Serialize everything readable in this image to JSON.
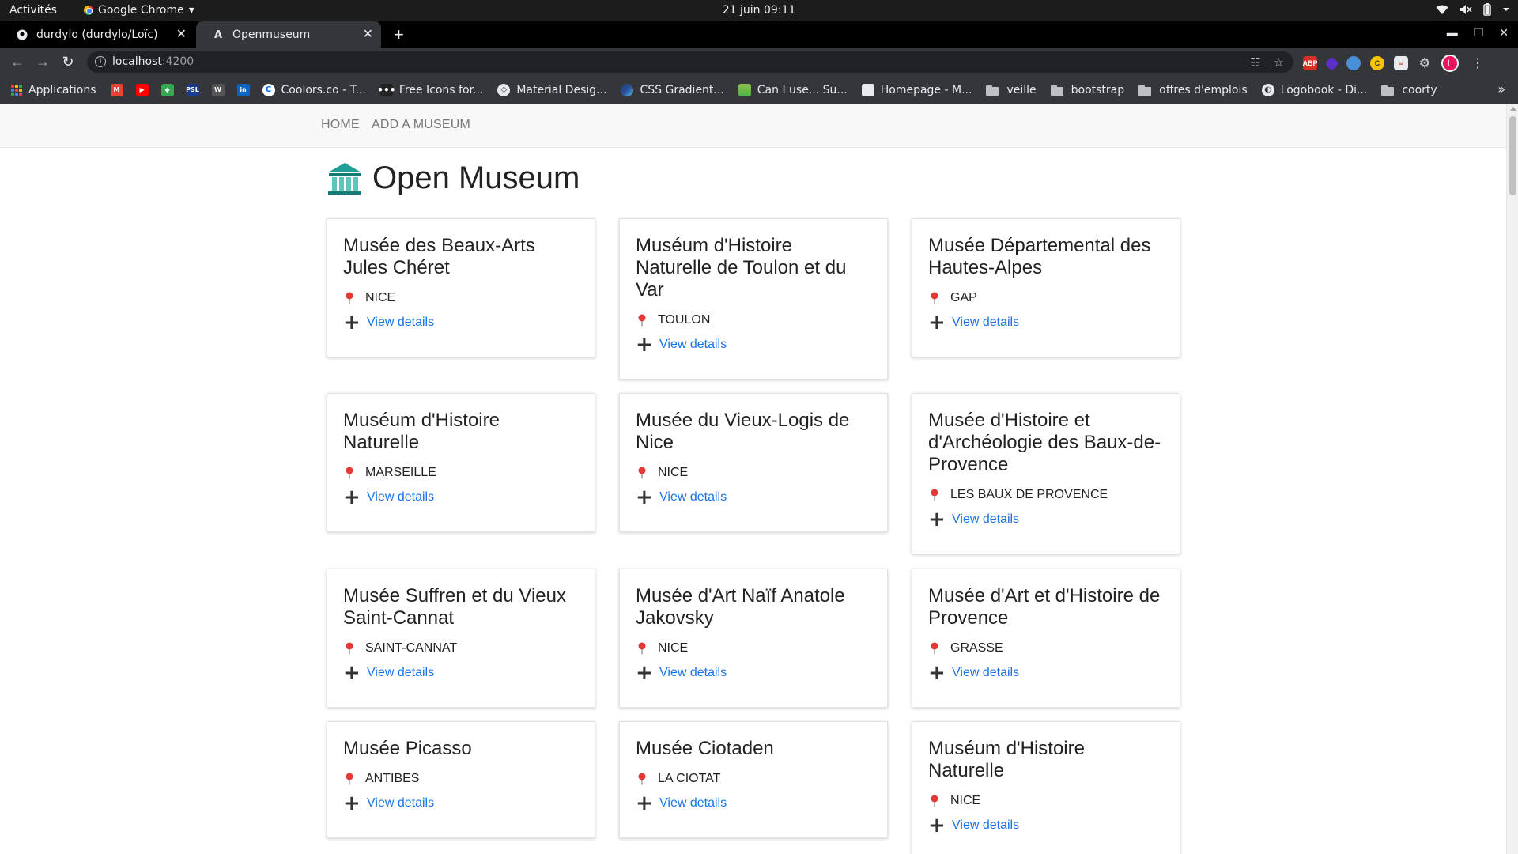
{
  "system_bar": {
    "activities": "Activités",
    "app_name": "Google Chrome",
    "clock": "21 juin  09:11"
  },
  "browser": {
    "tabs": [
      {
        "title": "durdylo (durdylo/Loïc)",
        "favicon": "github-icon"
      },
      {
        "title": "Openmuseum",
        "favicon": "angular-icon"
      }
    ],
    "url_host": "localhost",
    "url_port": ":4200",
    "avatar_letter": "L",
    "bookmarks": [
      {
        "label": "Applications",
        "icon": "apps-grid-icon"
      },
      {
        "label": "Coolors.co - T...",
        "icon": "coolors-icon"
      },
      {
        "label": "Free Icons for...",
        "icon": "icons-site-icon"
      },
      {
        "label": "Material Desig...",
        "icon": "material-design-icon"
      },
      {
        "label": "CSS Gradient...",
        "icon": "css-gradient-icon"
      },
      {
        "label": "Can I use... Su...",
        "icon": "caniuse-icon"
      },
      {
        "label": "Homepage - M...",
        "icon": "homepage-icon"
      },
      {
        "label": "veille",
        "icon": "folder-icon"
      },
      {
        "label": "bootstrap",
        "icon": "folder-icon"
      },
      {
        "label": "offres d'emplois",
        "icon": "folder-icon"
      },
      {
        "label": "Logobook - Di...",
        "icon": "logobook-icon"
      },
      {
        "label": "coorty",
        "icon": "folder-icon"
      }
    ]
  },
  "nav": {
    "home": "HOME",
    "add": "ADD A MUSEUM"
  },
  "brand": {
    "title": "Open Museum",
    "icon": "museum-icon"
  },
  "view_details_label": "View details",
  "museums": [
    {
      "name": "Musée des Beaux-Arts Jules Chéret",
      "city": "NICE"
    },
    {
      "name": "Muséum d'Histoire Naturelle de Toulon et du Var",
      "city": "TOULON"
    },
    {
      "name": "Musée Départemental des Hautes-Alpes",
      "city": "GAP"
    },
    {
      "name": "Muséum d'Histoire Naturelle",
      "city": "MARSEILLE"
    },
    {
      "name": "Musée du Vieux-Logis de Nice",
      "city": "NICE"
    },
    {
      "name": "Musée d'Histoire et d'Archéologie des Baux-de-Provence",
      "city": "LES BAUX DE PROVENCE"
    },
    {
      "name": "Musée Suffren et du Vieux Saint-Cannat",
      "city": "SAINT-CANNAT"
    },
    {
      "name": "Musée d'Art Naïf Anatole Jakovsky",
      "city": "NICE"
    },
    {
      "name": "Musée d'Art et d'Histoire de Provence",
      "city": "GRASSE"
    },
    {
      "name": "Musée Picasso",
      "city": "ANTIBES"
    },
    {
      "name": "Musée Ciotaden",
      "city": "LA CIOTAT"
    },
    {
      "name": "Muséum d'Histoire Naturelle",
      "city": "NICE"
    }
  ]
}
